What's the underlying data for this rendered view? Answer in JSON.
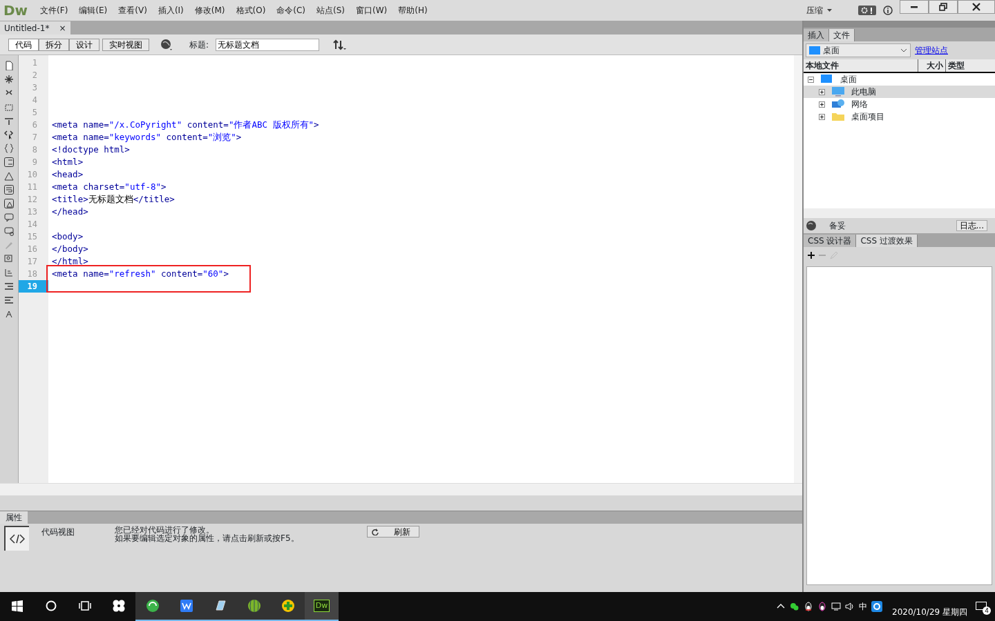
{
  "app": {
    "logo": "Dw",
    "menu": [
      "文件(F)",
      "编辑(E)",
      "查看(V)",
      "插入(I)",
      "修改(M)",
      "格式(O)",
      "命令(C)",
      "站点(S)",
      "窗口(W)",
      "帮助(H)"
    ],
    "compress_menu": "压缩"
  },
  "document_tabs": [
    {
      "label": "Untitled-1*",
      "selected": true,
      "close": "×"
    }
  ],
  "toolbar": {
    "views": [
      {
        "label": "代码",
        "selected": true
      },
      {
        "label": "拆分",
        "selected": false
      },
      {
        "label": "设计",
        "selected": false
      },
      {
        "label": "实时视图",
        "selected": false
      }
    ],
    "title_label": "标题:",
    "title_value": "无标题文档"
  },
  "editor": {
    "lines": [
      {
        "number": "1",
        "current": false,
        "highlighted": false
      },
      {
        "number": "2",
        "current": false,
        "highlighted": false
      },
      {
        "number": "3",
        "current": false,
        "highlighted": false
      },
      {
        "number": "4",
        "current": false,
        "highlighted": false
      },
      {
        "number": "5",
        "current": false,
        "highlighted": false
      },
      {
        "number": "6",
        "current": false,
        "highlighted": false,
        "segments": [
          {
            "kind": "tag",
            "text": "<meta name="
          },
          {
            "kind": "value",
            "text": "\"/x.CoPyright\""
          },
          {
            "kind": "tag",
            "text": " content="
          },
          {
            "kind": "value",
            "text": "\"作者ABC 版权所有\""
          },
          {
            "kind": "tag",
            "text": ">"
          }
        ]
      },
      {
        "number": "7",
        "current": false,
        "highlighted": false,
        "segments": [
          {
            "kind": "tag",
            "text": "<meta name="
          },
          {
            "kind": "value",
            "text": "\"keywords\""
          },
          {
            "kind": "tag",
            "text": " content="
          },
          {
            "kind": "value",
            "text": "\"浏览\""
          },
          {
            "kind": "tag",
            "text": ">"
          }
        ]
      },
      {
        "number": "8",
        "current": false,
        "highlighted": false,
        "segments": [
          {
            "kind": "tag",
            "text": "<!doctype html>"
          }
        ]
      },
      {
        "number": "9",
        "current": false,
        "highlighted": false,
        "segments": [
          {
            "kind": "tag",
            "text": "<html>"
          }
        ]
      },
      {
        "number": "10",
        "current": false,
        "highlighted": false,
        "segments": [
          {
            "kind": "tag",
            "text": "<head>"
          }
        ]
      },
      {
        "number": "11",
        "current": false,
        "highlighted": false,
        "segments": [
          {
            "kind": "tag",
            "text": "<meta charset="
          },
          {
            "kind": "value",
            "text": "\"utf-8\""
          },
          {
            "kind": "tag",
            "text": ">"
          }
        ]
      },
      {
        "number": "12",
        "current": false,
        "highlighted": false,
        "segments": [
          {
            "kind": "tag",
            "text": "<title>"
          },
          {
            "kind": "text",
            "text": "无标题文档"
          },
          {
            "kind": "tag",
            "text": "</title>"
          }
        ]
      },
      {
        "number": "13",
        "current": false,
        "highlighted": false,
        "segments": [
          {
            "kind": "tag",
            "text": "</head>"
          }
        ]
      },
      {
        "number": "14",
        "current": false,
        "highlighted": false
      },
      {
        "number": "15",
        "current": false,
        "highlighted": false,
        "segments": [
          {
            "kind": "tag",
            "text": "<body>"
          }
        ]
      },
      {
        "number": "16",
        "current": false,
        "highlighted": false,
        "segments": [
          {
            "kind": "tag",
            "text": "</body>"
          }
        ]
      },
      {
        "number": "17",
        "current": false,
        "highlighted": false,
        "segments": [
          {
            "kind": "tag",
            "text": "</html>"
          }
        ]
      },
      {
        "number": "18",
        "current": false,
        "highlighted": true,
        "segments": [
          {
            "kind": "tag",
            "text": "<meta name="
          },
          {
            "kind": "value",
            "text": "\"refresh\""
          },
          {
            "kind": "tag",
            "text": " content="
          },
          {
            "kind": "value",
            "text": "\"60\""
          },
          {
            "kind": "tag",
            "text": ">"
          }
        ]
      },
      {
        "number": "19",
        "current": true,
        "highlighted": true
      }
    ]
  },
  "properties": {
    "tab": "属性",
    "view_label": "代码视图",
    "message": [
      "您已经对代码进行了修改。",
      "如果要编辑选定对象的属性，请点击刷新或按F5。"
    ],
    "refresh_button": "刷新"
  },
  "files_panel": {
    "tabs": [
      {
        "label": "插入",
        "selected": false
      },
      {
        "label": "文件",
        "selected": true
      }
    ],
    "location": "桌面",
    "manage_link": "管理站点",
    "columns": [
      "本地文件",
      "大小",
      "类型"
    ],
    "tree": [
      {
        "label": "桌面",
        "kind": "desktop",
        "expanded": true,
        "selected": false,
        "children": [
          {
            "label": "此电脑",
            "kind": "computer",
            "expanded": false,
            "selected": true
          },
          {
            "label": "网络",
            "kind": "network",
            "expanded": false,
            "selected": false
          },
          {
            "label": "桌面项目",
            "kind": "folder",
            "expanded": false,
            "selected": false
          }
        ]
      }
    ],
    "status": "备妥",
    "log_button": "日志..."
  },
  "css_panel": {
    "tabs": [
      {
        "label": "CSS 设计器",
        "selected": false
      },
      {
        "label": "CSS 过渡效果",
        "selected": true
      }
    ]
  },
  "taskbar": {
    "app_logo": "Dw",
    "language": "中",
    "date": "2020/10/29 星期四",
    "notifications": "4"
  }
}
